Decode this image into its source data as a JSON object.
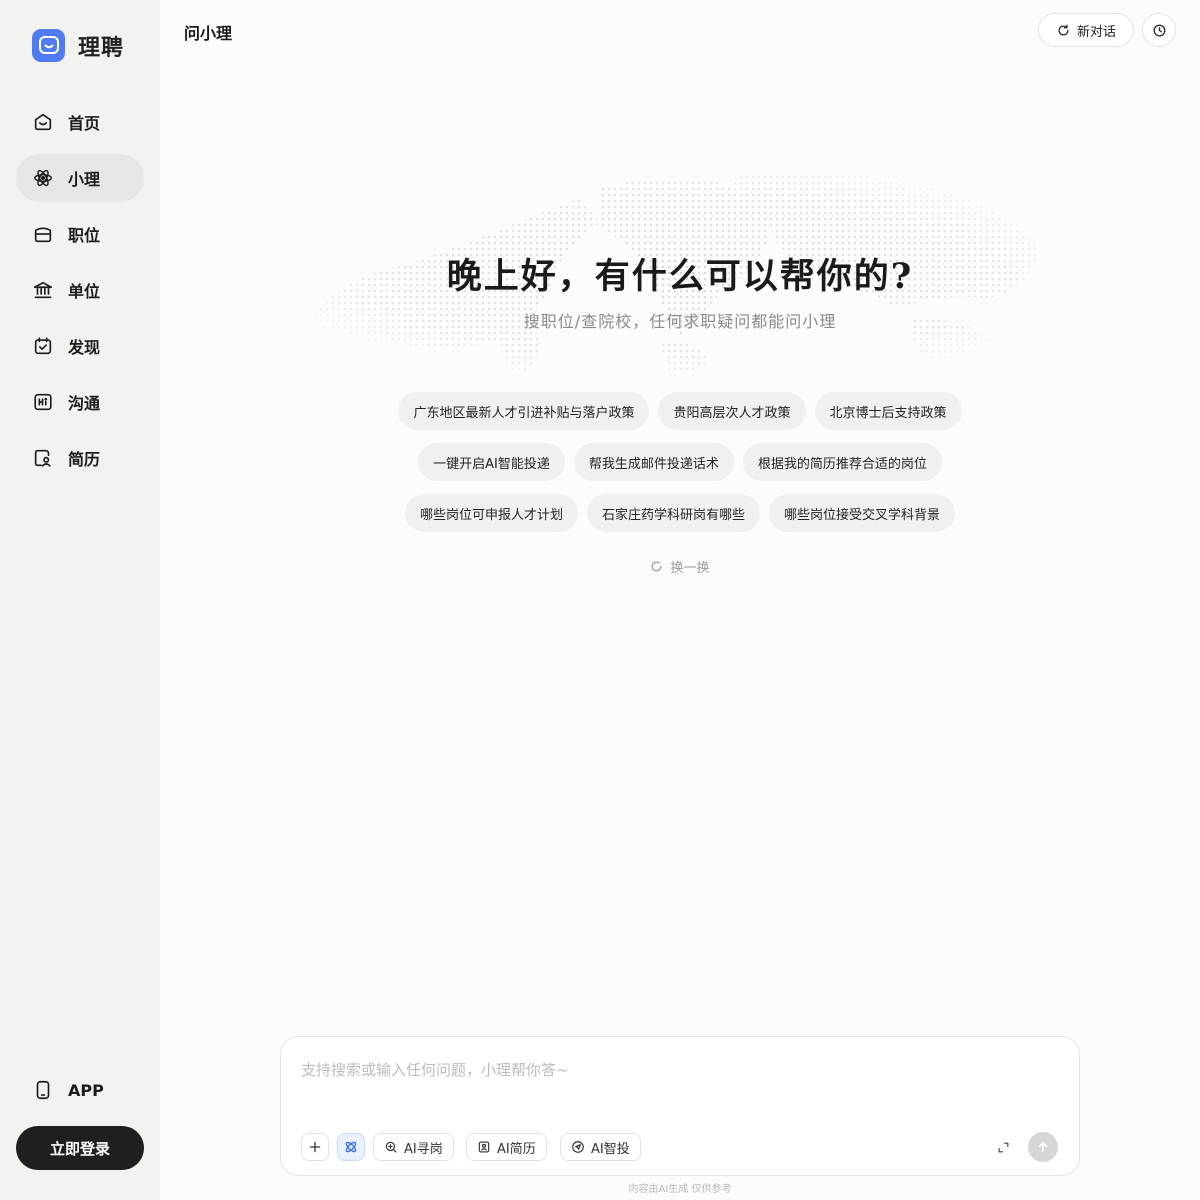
{
  "brand": {
    "name": "理聘"
  },
  "sidebar": {
    "items": [
      {
        "label": "首页",
        "icon": "home-icon",
        "active": false
      },
      {
        "label": "小理",
        "icon": "atom-icon",
        "active": true
      },
      {
        "label": "职位",
        "icon": "briefcase-icon",
        "active": false
      },
      {
        "label": "单位",
        "icon": "institution-icon",
        "active": false
      },
      {
        "label": "发现",
        "icon": "calendar-check-icon",
        "active": false
      },
      {
        "label": "沟通",
        "icon": "hi-chat-icon",
        "active": false
      },
      {
        "label": "简历",
        "icon": "resume-icon",
        "active": false
      }
    ],
    "app_label": "APP",
    "login_label": "立即登录"
  },
  "header": {
    "title": "问小理",
    "new_chat_label": "新对话"
  },
  "hero": {
    "greeting": "晚上好，有什么可以帮你的?",
    "subtitle": "搜职位/查院校，任何求职疑问都能问小理"
  },
  "suggestions": {
    "rows": [
      [
        "广东地区最新人才引进补贴与落户政策",
        "贵阳高层次人才政策",
        "北京博士后支持政策"
      ],
      [
        "一键开启AI智能投递",
        "帮我生成邮件投递话术",
        "根据我的简历推荐合适的岗位"
      ],
      [
        "哪些岗位可申报人才计划",
        "石家庄药学科研岗有哪些",
        "哪些岗位接受交叉学科背景"
      ]
    ],
    "refresh_label": "换一换"
  },
  "composer": {
    "placeholder": "支持搜索或输入任何问题，小理帮你答~",
    "tools": [
      {
        "label": "AI寻岗",
        "icon": "search-zoom-icon"
      },
      {
        "label": "AI简历",
        "icon": "resume-badge-icon"
      },
      {
        "label": "AI智投",
        "icon": "send-target-icon"
      }
    ]
  },
  "footer": {
    "disclaimer": "内容由AI生成 仅供参考"
  },
  "colors": {
    "brand": "#4f7cf3",
    "sidebar_bg": "#f2f2ef",
    "login_bg": "#1f1f1f"
  }
}
